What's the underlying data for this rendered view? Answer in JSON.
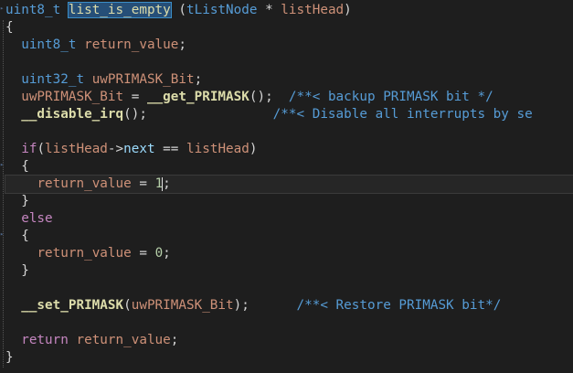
{
  "editor": {
    "lines": [
      {
        "tokens": [
          {
            "c": "t",
            "s": "uint8_t"
          },
          {
            "c": "txt",
            "s": " "
          },
          {
            "c": "fnhl",
            "s": "list_is_empty"
          },
          {
            "c": "txt",
            "s": " ("
          },
          {
            "c": "t",
            "s": "tListNode"
          },
          {
            "c": "txt",
            "s": " * "
          },
          {
            "c": "var",
            "s": "listHead"
          },
          {
            "c": "txt",
            "s": ")"
          }
        ]
      },
      {
        "tokens": [
          {
            "c": "txt",
            "s": "{"
          }
        ]
      },
      {
        "tokens": [
          {
            "c": "txt",
            "s": "  "
          },
          {
            "c": "t",
            "s": "uint8_t"
          },
          {
            "c": "txt",
            "s": " "
          },
          {
            "c": "var",
            "s": "return_value"
          },
          {
            "c": "txt",
            "s": ";"
          }
        ]
      },
      {
        "tokens": []
      },
      {
        "tokens": [
          {
            "c": "txt",
            "s": "  "
          },
          {
            "c": "t",
            "s": "uint32_t"
          },
          {
            "c": "txt",
            "s": " "
          },
          {
            "c": "var",
            "s": "uwPRIMASK_Bit"
          },
          {
            "c": "txt",
            "s": ";"
          }
        ]
      },
      {
        "tokens": [
          {
            "c": "txt",
            "s": "  "
          },
          {
            "c": "var",
            "s": "uwPRIMASK_Bit"
          },
          {
            "c": "txt",
            "s": " = "
          },
          {
            "c": "mac",
            "s": "__get_PRIMASK"
          },
          {
            "c": "txt",
            "s": "();  "
          },
          {
            "c": "cm",
            "s": "/**< backup PRIMASK bit */"
          }
        ]
      },
      {
        "tokens": [
          {
            "c": "txt",
            "s": "  "
          },
          {
            "c": "mac",
            "s": "__disable_irq"
          },
          {
            "c": "txt",
            "s": "();                "
          },
          {
            "c": "cm",
            "s": "/**< Disable all interrupts by se"
          }
        ]
      },
      {
        "tokens": []
      },
      {
        "tokens": [
          {
            "c": "txt",
            "s": "  "
          },
          {
            "c": "kw",
            "s": "if"
          },
          {
            "c": "txt",
            "s": "("
          },
          {
            "c": "var",
            "s": "listHead"
          },
          {
            "c": "txt",
            "s": "->"
          },
          {
            "c": "mem",
            "s": "next"
          },
          {
            "c": "txt",
            "s": " == "
          },
          {
            "c": "var",
            "s": "listHead"
          },
          {
            "c": "txt",
            "s": ")"
          }
        ]
      },
      {
        "tokens": [
          {
            "c": "txt",
            "s": "  {"
          }
        ]
      },
      {
        "tokens": [
          {
            "c": "txt",
            "s": "    "
          },
          {
            "c": "var",
            "s": "return_value"
          },
          {
            "c": "txt",
            "s": " = "
          },
          {
            "c": "num",
            "s": "1"
          },
          {
            "c": "caret",
            "s": ""
          },
          {
            "c": "txt",
            "s": ";"
          }
        ],
        "current": true
      },
      {
        "tokens": [
          {
            "c": "txt",
            "s": "  }"
          }
        ]
      },
      {
        "tokens": [
          {
            "c": "txt",
            "s": "  "
          },
          {
            "c": "kw",
            "s": "else"
          }
        ]
      },
      {
        "tokens": [
          {
            "c": "txt",
            "s": "  {"
          }
        ]
      },
      {
        "tokens": [
          {
            "c": "txt",
            "s": "    "
          },
          {
            "c": "var",
            "s": "return_value"
          },
          {
            "c": "txt",
            "s": " = "
          },
          {
            "c": "num",
            "s": "0"
          },
          {
            "c": "txt",
            "s": ";"
          }
        ]
      },
      {
        "tokens": [
          {
            "c": "txt",
            "s": "  }"
          }
        ]
      },
      {
        "tokens": []
      },
      {
        "tokens": [
          {
            "c": "txt",
            "s": "  "
          },
          {
            "c": "mac",
            "s": "__set_PRIMASK"
          },
          {
            "c": "txt",
            "s": "("
          },
          {
            "c": "var",
            "s": "uwPRIMASK_Bit"
          },
          {
            "c": "txt",
            "s": ");      "
          },
          {
            "c": "cm",
            "s": "/**< Restore PRIMASK bit*/"
          }
        ]
      },
      {
        "tokens": []
      },
      {
        "tokens": [
          {
            "c": "txt",
            "s": "  "
          },
          {
            "c": "kw",
            "s": "return"
          },
          {
            "c": "txt",
            "s": " "
          },
          {
            "c": "var",
            "s": "return_value"
          },
          {
            "c": "txt",
            "s": ";"
          }
        ]
      },
      {
        "tokens": [
          {
            "c": "txt",
            "s": "}"
          }
        ]
      }
    ]
  },
  "colors": {
    "background": "#1e1e1e",
    "current_line": "#262626",
    "function_highlight": "#264f78"
  }
}
